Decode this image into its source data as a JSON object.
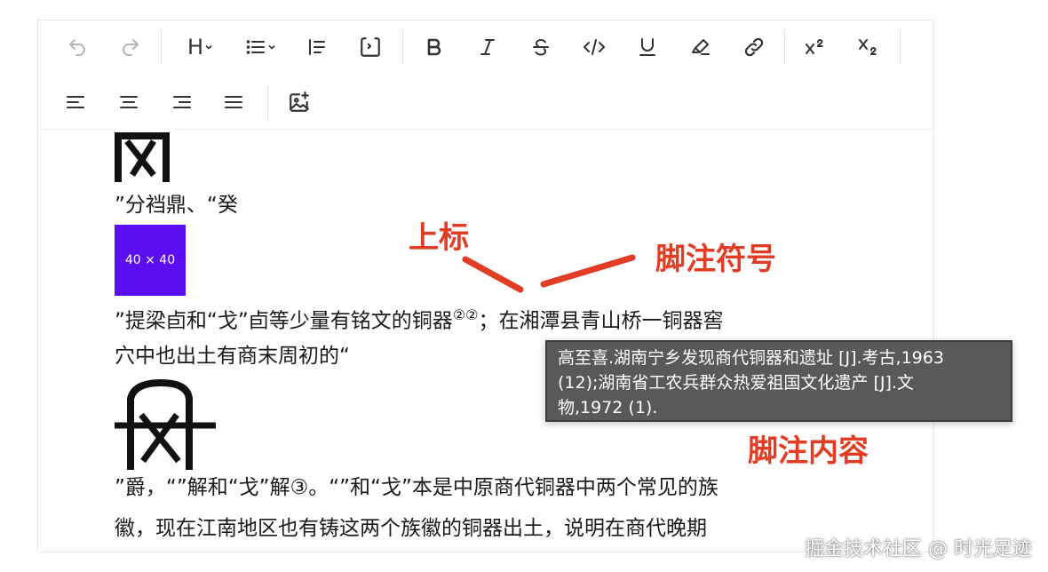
{
  "toolbar": {
    "row1": [
      {
        "name": "undo-button",
        "icon": "undo-icon",
        "disabled": true
      },
      {
        "name": "redo-button",
        "icon": "redo-icon",
        "disabled": true
      },
      {
        "name": "heading-button",
        "icon": "heading-icon",
        "label": "H"
      },
      {
        "name": "list-button",
        "icon": "list-icon"
      },
      {
        "name": "blockquote-button",
        "icon": "blockquote-icon"
      },
      {
        "name": "code-block-button",
        "icon": "code-block-icon"
      },
      {
        "name": "bold-button",
        "icon": "bold-icon"
      },
      {
        "name": "italic-button",
        "icon": "italic-icon"
      },
      {
        "name": "strike-button",
        "icon": "strikethrough-icon"
      },
      {
        "name": "code-button",
        "icon": "code-icon"
      },
      {
        "name": "underline-button",
        "icon": "underline-icon"
      },
      {
        "name": "highlight-button",
        "icon": "highlighter-icon"
      },
      {
        "name": "link-button",
        "icon": "link-icon"
      },
      {
        "name": "superscript-button",
        "icon": "superscript-icon"
      },
      {
        "name": "subscript-button",
        "icon": "subscript-icon"
      }
    ],
    "heading_label": "H",
    "row2": [
      {
        "name": "align-left-button",
        "icon": "align-left-icon"
      },
      {
        "name": "align-center-button",
        "icon": "align-center-icon"
      },
      {
        "name": "align-right-button",
        "icon": "align-right-icon"
      },
      {
        "name": "align-justify-button",
        "icon": "align-justify-icon"
      },
      {
        "name": "insert-image-button",
        "icon": "image-add-icon"
      }
    ]
  },
  "content": {
    "line1": "”分裆鼎、“癸",
    "placeholder_label": "40 × 40",
    "line2_text": "”提梁卣和“戈”卣等少量有铭文的铜器",
    "line2_sup": "②②",
    "line2_after": "；在湘潭县青山桥一铜器窖",
    "line3": "穴中也出土有商末周初的“",
    "line4": "”爵，“”解和“戈”解③。“”和“戈”本是中原商代铜器中两个常见的族",
    "line5": "徽，现在江南地区也有铸这两个族徽的铜器出土，说明在商代晚期"
  },
  "tooltip": {
    "lines": [
      "高至喜.湖南宁乡发现商代铜器和遗址 [J].考古,1963",
      "(12);湖南省工农兵群众热爱祖国文化遗产 [J].文",
      "物,1972 (1)."
    ]
  },
  "annotations": {
    "superscript": "上标",
    "footnote_symbol": "脚注符号",
    "footnote_content": "脚注内容"
  },
  "watermark": "掘金技术社区 @ 时光足迹",
  "colors": {
    "annotation": "#e23d24",
    "tooltip_bg": "#595959",
    "placeholder": "#5b0ef2"
  }
}
